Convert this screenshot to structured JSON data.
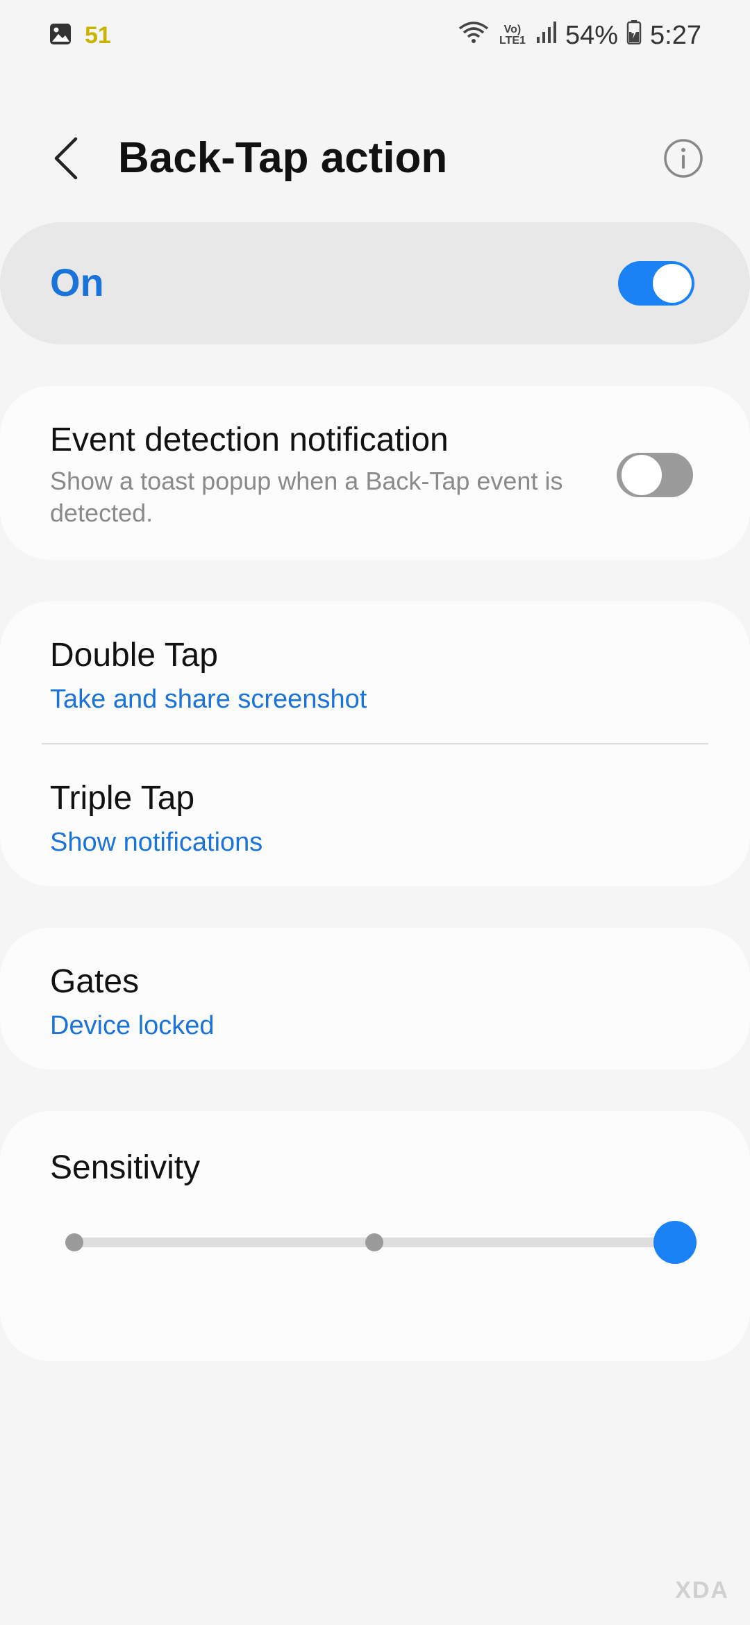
{
  "status_bar": {
    "notification_count": "51",
    "battery": "54%",
    "time": "5:27",
    "network_label": "Vo) LTE1",
    "icons": [
      "gallery-icon",
      "wifi-icon",
      "volte-icon",
      "signal-icon",
      "battery-charging-icon"
    ]
  },
  "header": {
    "title": "Back-Tap action",
    "back_icon": "chevron-left-icon",
    "info_icon": "info-icon"
  },
  "master_switch": {
    "label": "On",
    "enabled": true
  },
  "event_notification": {
    "title": "Event detection notification",
    "description": "Show a toast popup when a Back-Tap event is detected.",
    "enabled": false
  },
  "tap_actions": [
    {
      "title": "Double Tap",
      "value": "Take and share screenshot"
    },
    {
      "title": "Triple Tap",
      "value": "Show notifications"
    }
  ],
  "gates": {
    "title": "Gates",
    "value": "Device locked"
  },
  "sensitivity": {
    "title": "Sensitivity",
    "levels": 3,
    "selected_level": 3
  },
  "watermark": "XDA",
  "colors": {
    "accent": "#1a73d9",
    "toggle_on": "#1a82f5",
    "toggle_off": "#9a9a9a",
    "background": "#f5f5f5",
    "card": "#fcfcfc"
  }
}
